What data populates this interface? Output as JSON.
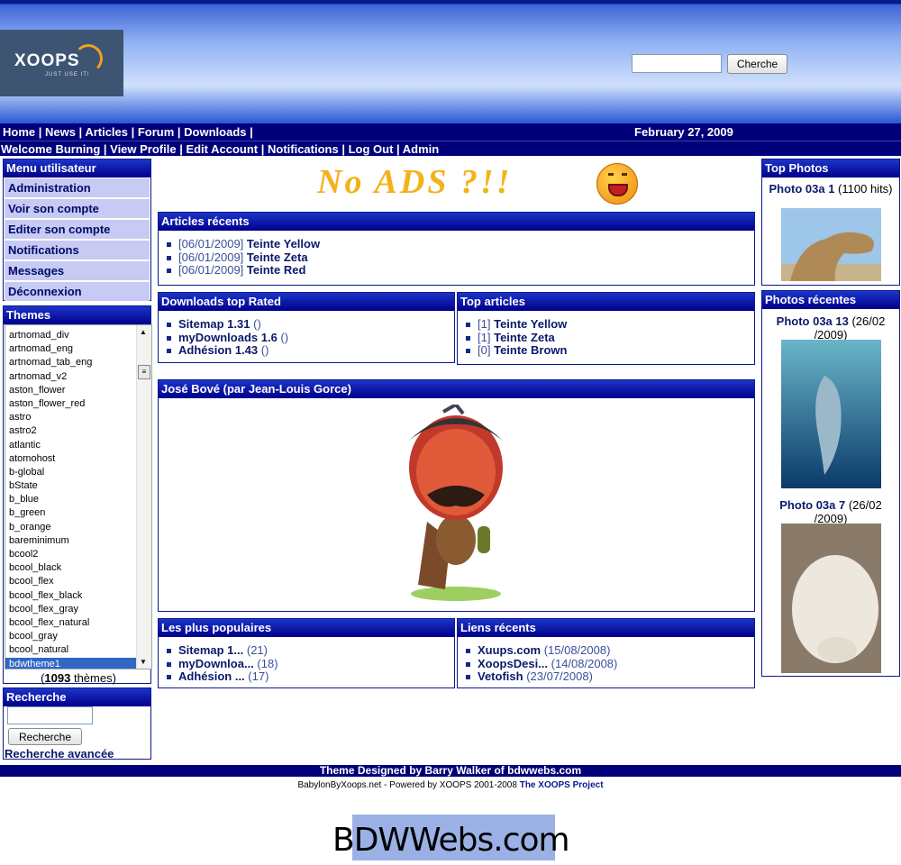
{
  "header": {
    "logo_text": "XOOPS",
    "logo_tagline": "JUST USE IT!",
    "search_value": "",
    "search_button": "Cherche"
  },
  "nav": {
    "main_links": "Home | News | Articles | Forum | Downloads |",
    "date": "February 27, 2009",
    "user_links": "Welcome Burning | View Profile | Edit Account | Notifications | Log Out | Admin"
  },
  "user_menu": {
    "title": "Menu utilisateur",
    "items": [
      "Administration",
      "Voir son compte",
      "Editer son compte",
      "Notifications",
      "Messages",
      "Déconnexion"
    ]
  },
  "themes": {
    "title": "Themes",
    "items": [
      "artnomad_div",
      "artnomad_eng",
      "artnomad_tab_eng",
      "artnomad_v2",
      "aston_flower",
      "aston_flower_red",
      "astro",
      "astro2",
      "atlantic",
      "atomohost",
      "b-global",
      "bState",
      "b_blue",
      "b_green",
      "b_orange",
      "bareminimum",
      "bcool2",
      "bcool_black",
      "bcool_flex",
      "bcool_flex_black",
      "bcool_flex_gray",
      "bcool_flex_natural",
      "bcool_gray",
      "bcool_natural",
      "bdwtheme1"
    ],
    "selected": "bdwtheme1",
    "count_number": "1093",
    "count_label": " thèmes)",
    "count_open": "("
  },
  "search": {
    "title": "Recherche",
    "input_value": "",
    "button": "Recherche",
    "advanced_link": "Recherche avancée"
  },
  "banner": {
    "text": "No ADS ?!!"
  },
  "articles_recents": {
    "title": "Articles récents",
    "items": [
      {
        "date": "[06/01/2009]",
        "name": "Teinte Yellow"
      },
      {
        "date": "[06/01/2009]",
        "name": "Teinte Zeta"
      },
      {
        "date": "[06/01/2009]",
        "name": "Teinte Red"
      }
    ]
  },
  "downloads_top": {
    "title": "Downloads top Rated",
    "items": [
      {
        "name": "Sitemap 1.31",
        "extra": " ()"
      },
      {
        "name": "myDownloads 1.6",
        "extra": " ()"
      },
      {
        "name": "Adhésion 1.43",
        "extra": " ()"
      }
    ]
  },
  "top_articles": {
    "title": "Top articles",
    "items": [
      {
        "rank": "[1]",
        "name": "Teinte Yellow"
      },
      {
        "rank": "[1]",
        "name": "Teinte Zeta"
      },
      {
        "rank": "[0]",
        "name": "Teinte Brown"
      }
    ]
  },
  "featured": {
    "title": "José Bové (par Jean-Louis Gorce)"
  },
  "populaires": {
    "title": "Les plus populaires",
    "items": [
      {
        "name": "Sitemap 1...",
        "extra": " (21)"
      },
      {
        "name": "myDownloa...",
        "extra": " (18)"
      },
      {
        "name": "Adhésion ...",
        "extra": " (17)"
      }
    ]
  },
  "liens_recents": {
    "title": "Liens récents",
    "items": [
      {
        "name": "Xuups.com",
        "extra": " (15/08/2008)"
      },
      {
        "name": "XoopsDesi...",
        "extra": " (14/08/2008)"
      },
      {
        "name": "Vetofish",
        "extra": " (23/07/2008)"
      }
    ]
  },
  "top_photos": {
    "title": "Top Photos",
    "items": [
      {
        "name": "Photo 03a 1",
        "extra": " (1100 hits)"
      }
    ]
  },
  "photos_recentes": {
    "title": "Photos récentes",
    "items": [
      {
        "name": "Photo 03a 13",
        "extra": " (26/02 /2009)"
      },
      {
        "name": "Photo 03a 7",
        "extra": " (26/02 /2009)"
      }
    ]
  },
  "footer": {
    "designed": "Theme Designed by Barry Walker of bdwwebs.com",
    "powered": "BabylonByXoops.net - Powered by XOOPS 2001-2008 ",
    "project_link": "The XOOPS Project",
    "bdw_logo": "BDWWebs.com"
  }
}
